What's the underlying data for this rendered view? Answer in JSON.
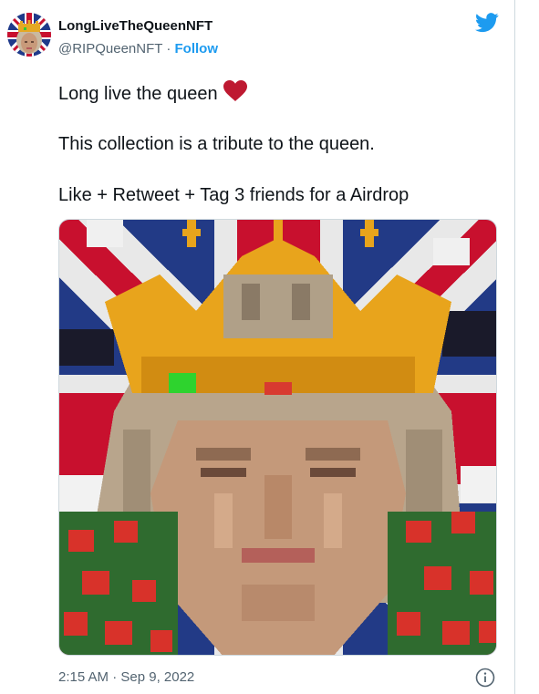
{
  "tweet": {
    "display_name": "LongLiveTheQueenNFT",
    "handle": "@RIPQueenNFT",
    "separator": "·",
    "follow_label": "Follow",
    "lines": [
      "Long live the queen",
      "This collection is a tribute to the queen.",
      "Like + Retweet + Tag 3 friends for a Airdrop"
    ],
    "timestamp": "2:15 AM · Sep 9, 2022"
  },
  "colors": {
    "accent": "#1d9bf0",
    "heart": "#be1931",
    "secondary_text": "#536471"
  },
  "icons": {
    "brand": "twitter-bird-icon",
    "emoji": "red-heart-icon",
    "info": "info-icon"
  }
}
